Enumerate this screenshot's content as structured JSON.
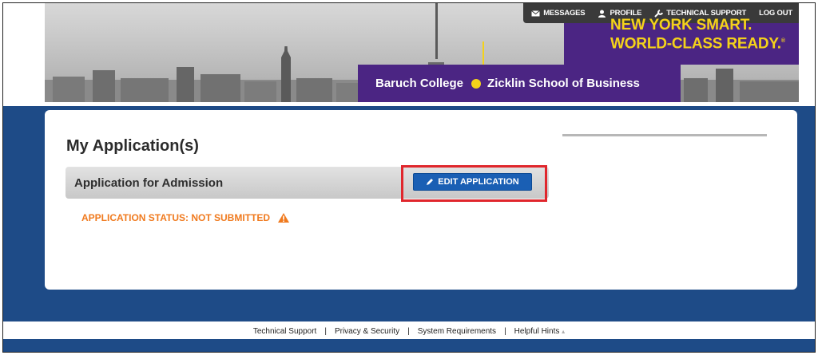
{
  "topnav": {
    "messages": "MESSAGES",
    "profile": "PROFILE",
    "support": "TECHNICAL SUPPORT",
    "logout": "LOG OUT"
  },
  "banner": {
    "slogan_line1": "NEW YORK SMART.",
    "slogan_line2": "WORLD-CLASS READY.",
    "slogan_mark": "®",
    "college": "Baruch College",
    "school": "Zicklin School of Business"
  },
  "main": {
    "page_title": "My Application(s)",
    "application_title": "Application for Admission",
    "edit_button": "EDIT APPLICATION",
    "status_text": "APPLICATION STATUS: NOT SUBMITTED"
  },
  "footer": {
    "links": [
      "Technical Support",
      "Privacy & Security",
      "System Requirements",
      "Helpful Hints"
    ],
    "helpful_hints_suffix": "▴"
  },
  "colors": {
    "brand_purple": "#4b2583",
    "brand_yellow": "#f4d21a",
    "page_blue": "#1e4b87",
    "button_blue": "#1a5fb4",
    "status_orange": "#f07a1e",
    "highlight_red": "#e0262c"
  }
}
